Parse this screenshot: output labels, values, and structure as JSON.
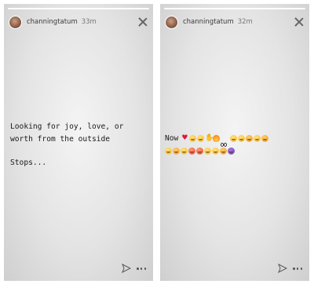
{
  "stories": [
    {
      "username": "channingtatum",
      "time": "33m",
      "caption_lines": [
        "Looking for joy, love, or",
        "worth from the outside",
        "",
        "Stops..."
      ]
    },
    {
      "username": "channingtatum",
      "time": "32m",
      "prefix": "Now",
      "emoji_row1": [
        "red-heart",
        "grinning-sweat",
        "grinning-squint",
        "folded-hands",
        "fire",
        "eyes",
        "grinning",
        "winking-kiss",
        "smiling-hearts",
        "tongue-out",
        "party-face"
      ],
      "emoji_row2": [
        "grimacing",
        "steam-face",
        "joy-tears",
        "angry-face",
        "pouting-face",
        "sweat-smile",
        "laughing",
        "smiling-face",
        "smiling-devil"
      ]
    }
  ],
  "colors": {
    "heart": "#e0163d",
    "text": "#1a1a1a"
  }
}
